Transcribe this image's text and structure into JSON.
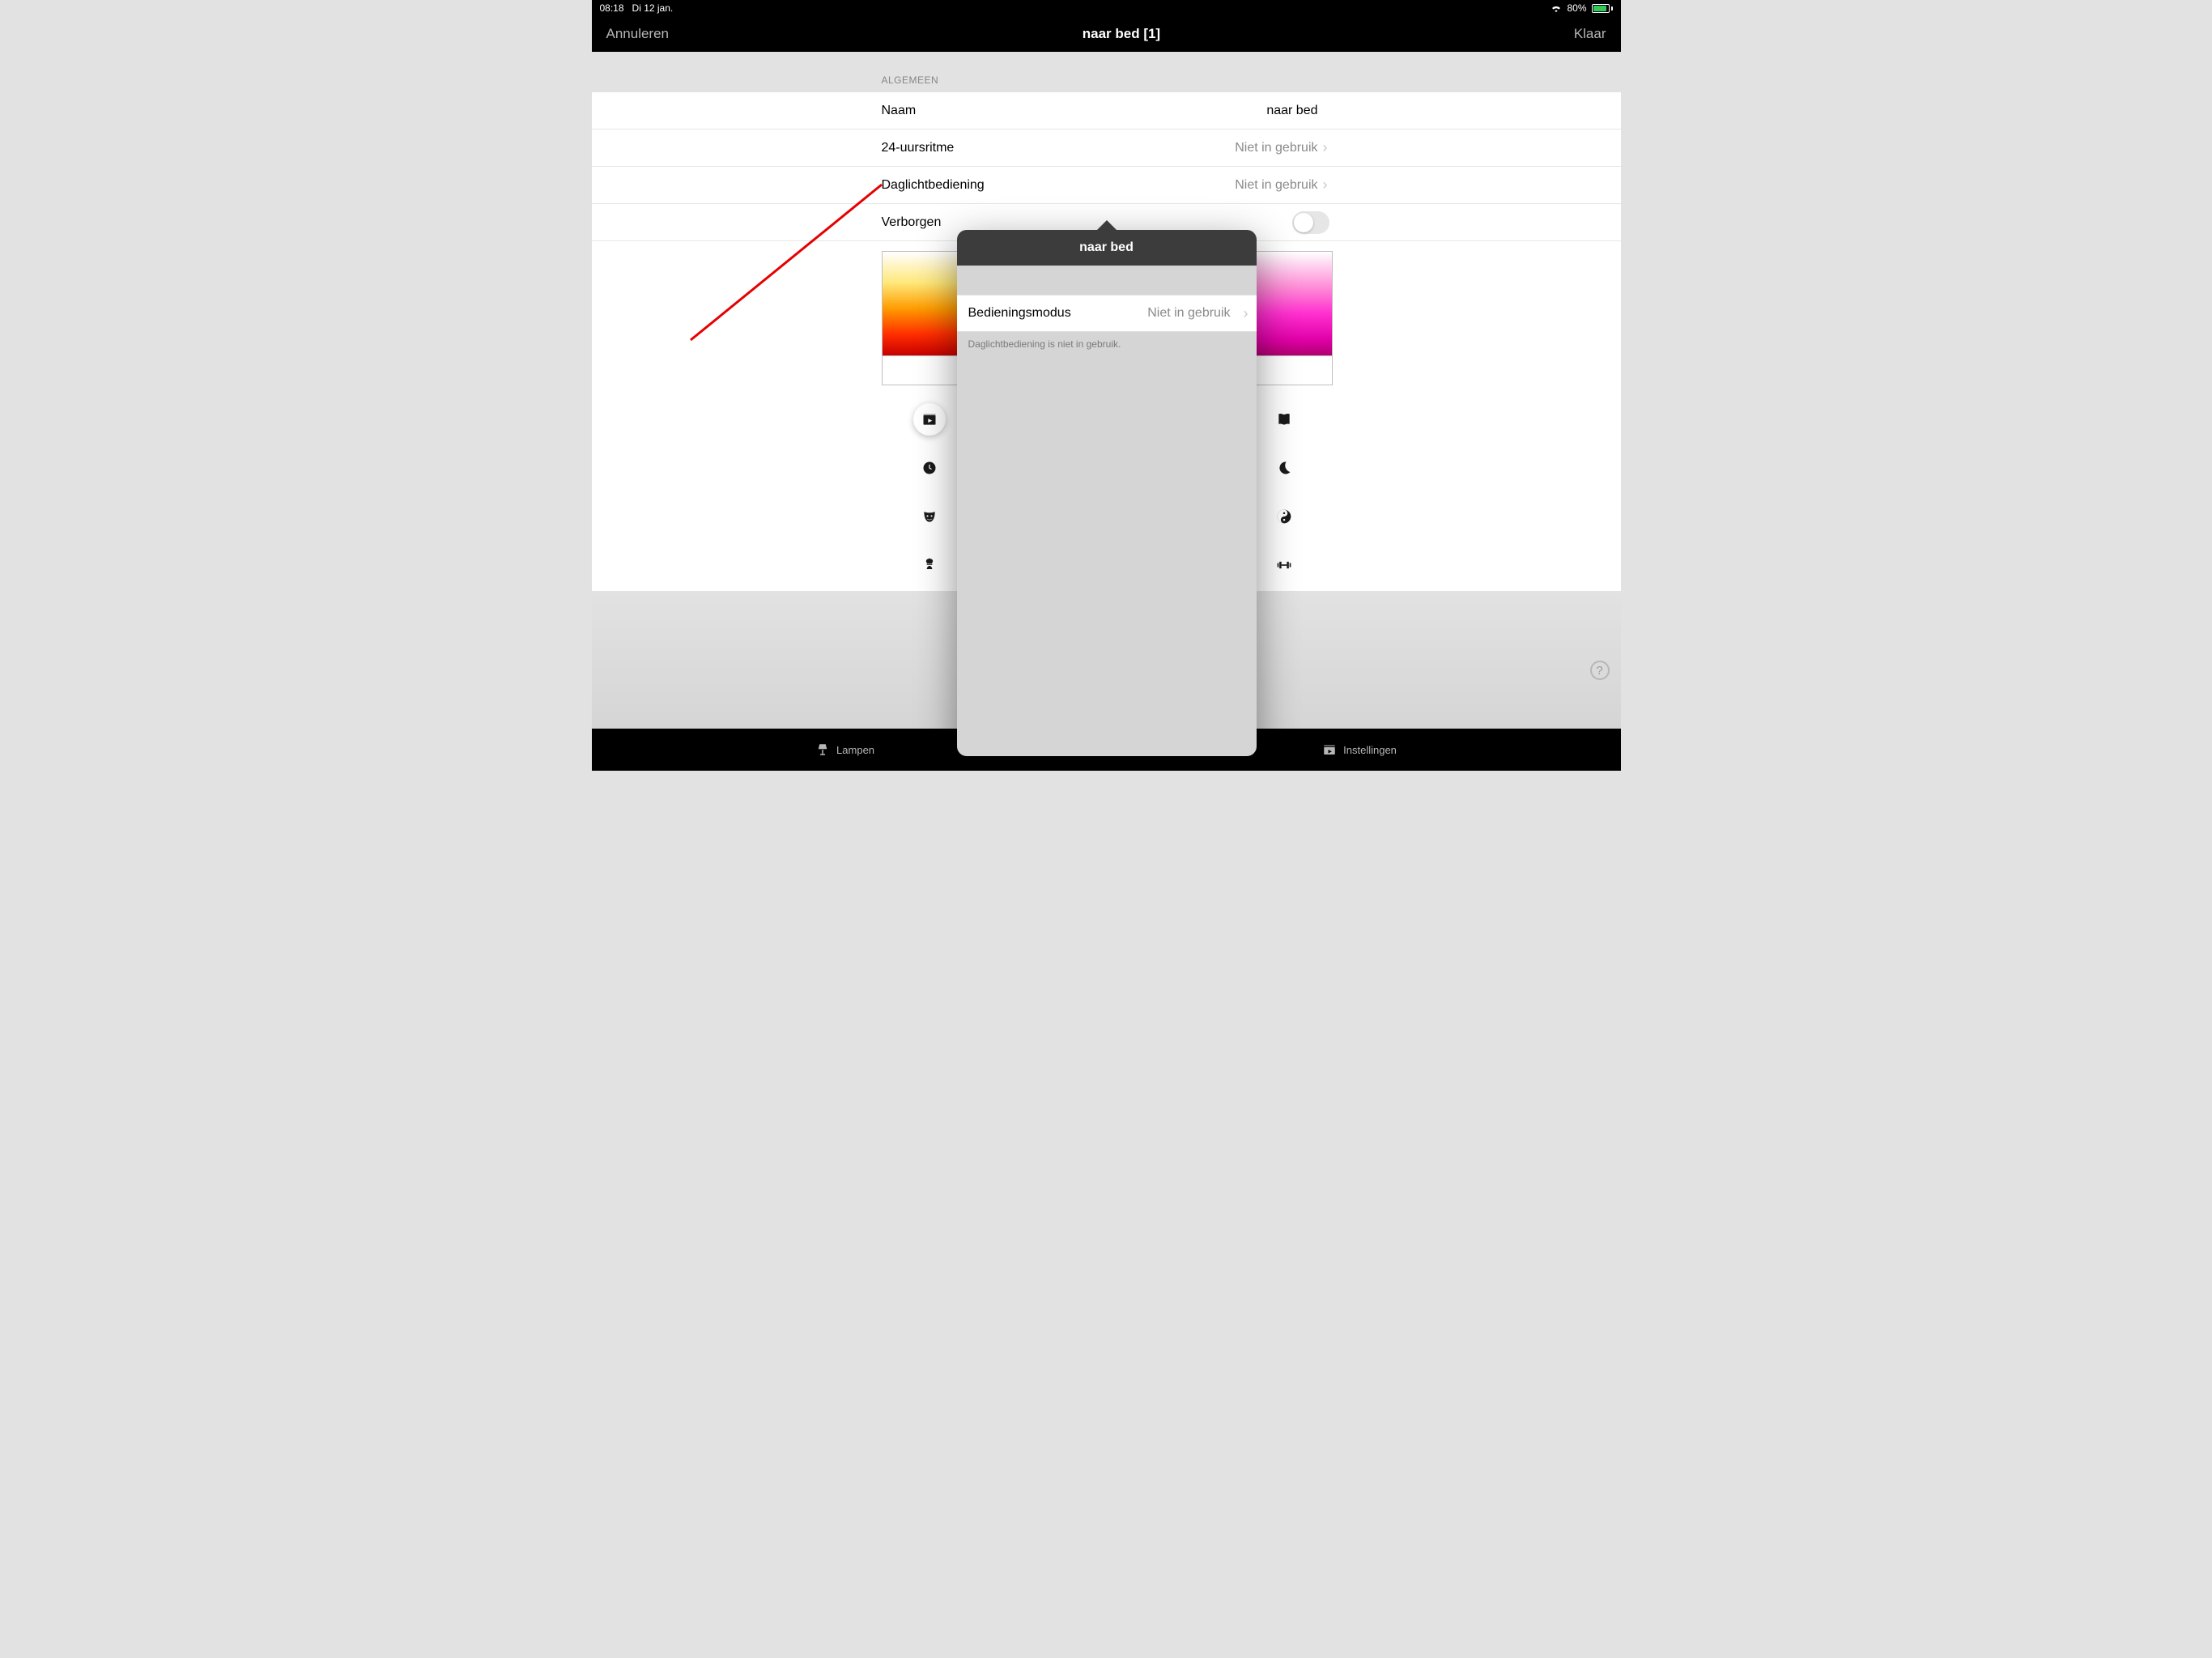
{
  "status": {
    "time": "08:18",
    "date": "Di 12 jan.",
    "battery_pct": "80%"
  },
  "nav": {
    "cancel": "Annuleren",
    "title": "naar bed [1]",
    "done": "Klaar"
  },
  "section": {
    "general": "ALGEMEEN"
  },
  "rows": {
    "name_label": "Naam",
    "name_value": "naar bed",
    "circadian_label": "24-uursritme",
    "circadian_value": "Niet in gebruik",
    "daylight_label": "Daglichtbediening",
    "daylight_value": "Niet in gebruik",
    "hidden_label": "Verborgen"
  },
  "scene_icons": [
    {
      "id": "movie-icon"
    },
    {
      "id": "book-icon"
    },
    {
      "id": "clock-icon"
    },
    {
      "id": "moon-icon"
    },
    {
      "id": "comedy-mask-icon"
    },
    {
      "id": "yinyang-icon"
    },
    {
      "id": "chef-icon"
    },
    {
      "id": "dumbbell-icon"
    }
  ],
  "popover": {
    "title": "naar bed",
    "mode_label": "Bedieningsmodus",
    "mode_value": "Niet in gebruik",
    "note": "Daglichtbediening is niet in gebruik."
  },
  "tabs": {
    "lamps": "Lampen",
    "settings": "Instellingen"
  },
  "help": "?"
}
